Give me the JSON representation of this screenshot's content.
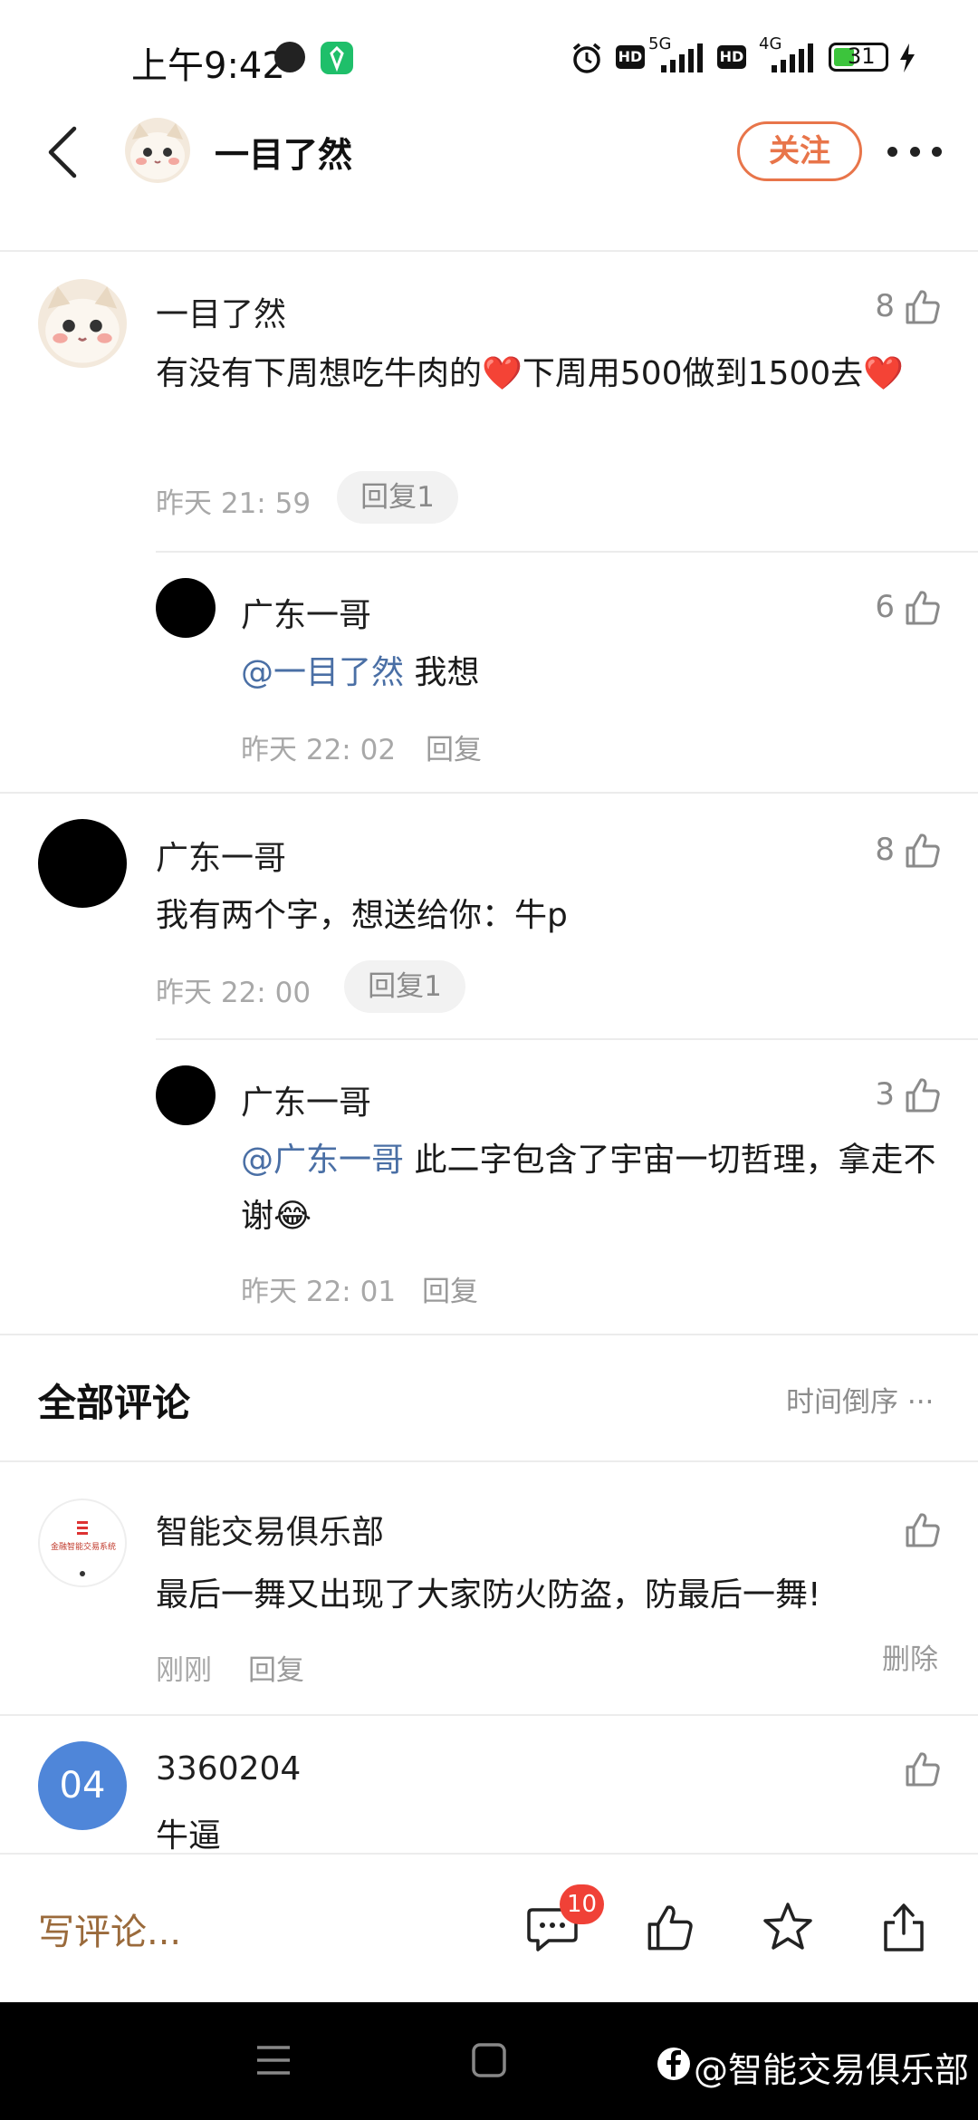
{
  "status_bar": {
    "time": "上午9:42",
    "battery_level": "31",
    "net1": "5G",
    "net2": "4G",
    "hd": "HD"
  },
  "header": {
    "user_name": "一目了然",
    "follow_label": "关注"
  },
  "thread": {
    "comment1": {
      "author": "一目了然",
      "text": "有没有下周想吃牛肉的❤️下周用500做到1500去❤️",
      "time": "昨天 21: 59",
      "reply_label": "回复1",
      "likes": "8",
      "reply": {
        "author": "广东一哥",
        "mention": "@一目了然",
        "text": " 我想",
        "time": "昨天 22: 02",
        "reply_label": "回复",
        "likes": "6"
      }
    },
    "comment2": {
      "author": "广东一哥",
      "text": "我有两个字，想送给你：牛p",
      "time": "昨天 22: 00",
      "reply_label": "回复1",
      "likes": "8",
      "reply": {
        "author": "广东一哥",
        "mention": "@广东一哥",
        "text": " 此二字包含了宇宙一切哲理，拿走不谢😂",
        "time": "昨天 22: 01",
        "reply_label": "回复",
        "likes": "3"
      }
    }
  },
  "all_comments": {
    "title": "全部评论",
    "sort_label": "时间倒序 ···",
    "items": [
      {
        "author": "智能交易俱乐部",
        "avatar_text": "金融智能交易系统",
        "text": "最后一舞又出现了大家防火防盗，防最后一舞!",
        "time": "刚刚",
        "reply_label": "回复",
        "delete_label": "删除"
      },
      {
        "author": "3360204",
        "avatar_text": "04",
        "text": "牛逼"
      }
    ]
  },
  "bottom_bar": {
    "write_placeholder": "写评论...",
    "comment_count": "10"
  },
  "watermark": "@智能交易俱乐部",
  "colors": {
    "accent": "#e8754a",
    "mention": "#4a6fa5",
    "badge": "#f04137",
    "avatar_blue": "#4f86d9"
  }
}
